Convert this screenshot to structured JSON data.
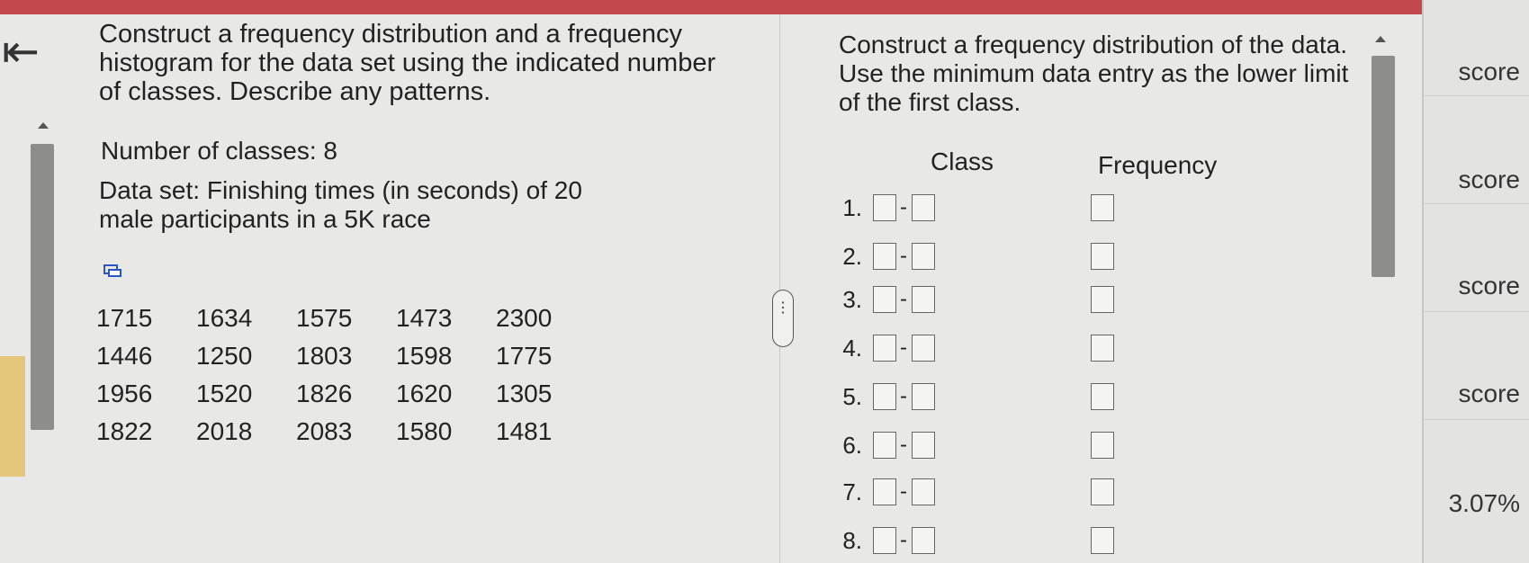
{
  "nav": {
    "back_glyph": "⇤",
    "back_icon": "back-arrow-icon"
  },
  "question": {
    "text": "Construct a frequency distribution and a frequency histogram for the data set using the indicated number of classes. Describe any patterns.",
    "num_classes": "Number of classes: 8",
    "dataset": "Data set: Finishing times (in seconds) of 20 male participants in a 5K race"
  },
  "data_table": [
    [
      "1715",
      "1634",
      "1575",
      "1473",
      "2300"
    ],
    [
      "1446",
      "1250",
      "1803",
      "1598",
      "1775"
    ],
    [
      "1956",
      "1520",
      "1826",
      "1620",
      "1305"
    ],
    [
      "1822",
      "2018",
      "2083",
      "1580",
      "1481"
    ]
  ],
  "answer": {
    "instruction": "Construct a frequency distribution of the data. Use the minimum data entry as the lower limit of the first class.",
    "class_header": "Class",
    "freq_header": "Frequency",
    "dash": "-",
    "rows": [
      "1.",
      "2.",
      "3.",
      "4.",
      "5.",
      "6.",
      "7.",
      "8."
    ]
  },
  "handle": {
    "dots": "⋮"
  },
  "side_panel": {
    "labels": [
      "score",
      "score",
      "score",
      "score",
      "3.07%"
    ]
  },
  "colors": {
    "accent_bar": "#c3484d",
    "highlight": "#e4c77c"
  }
}
